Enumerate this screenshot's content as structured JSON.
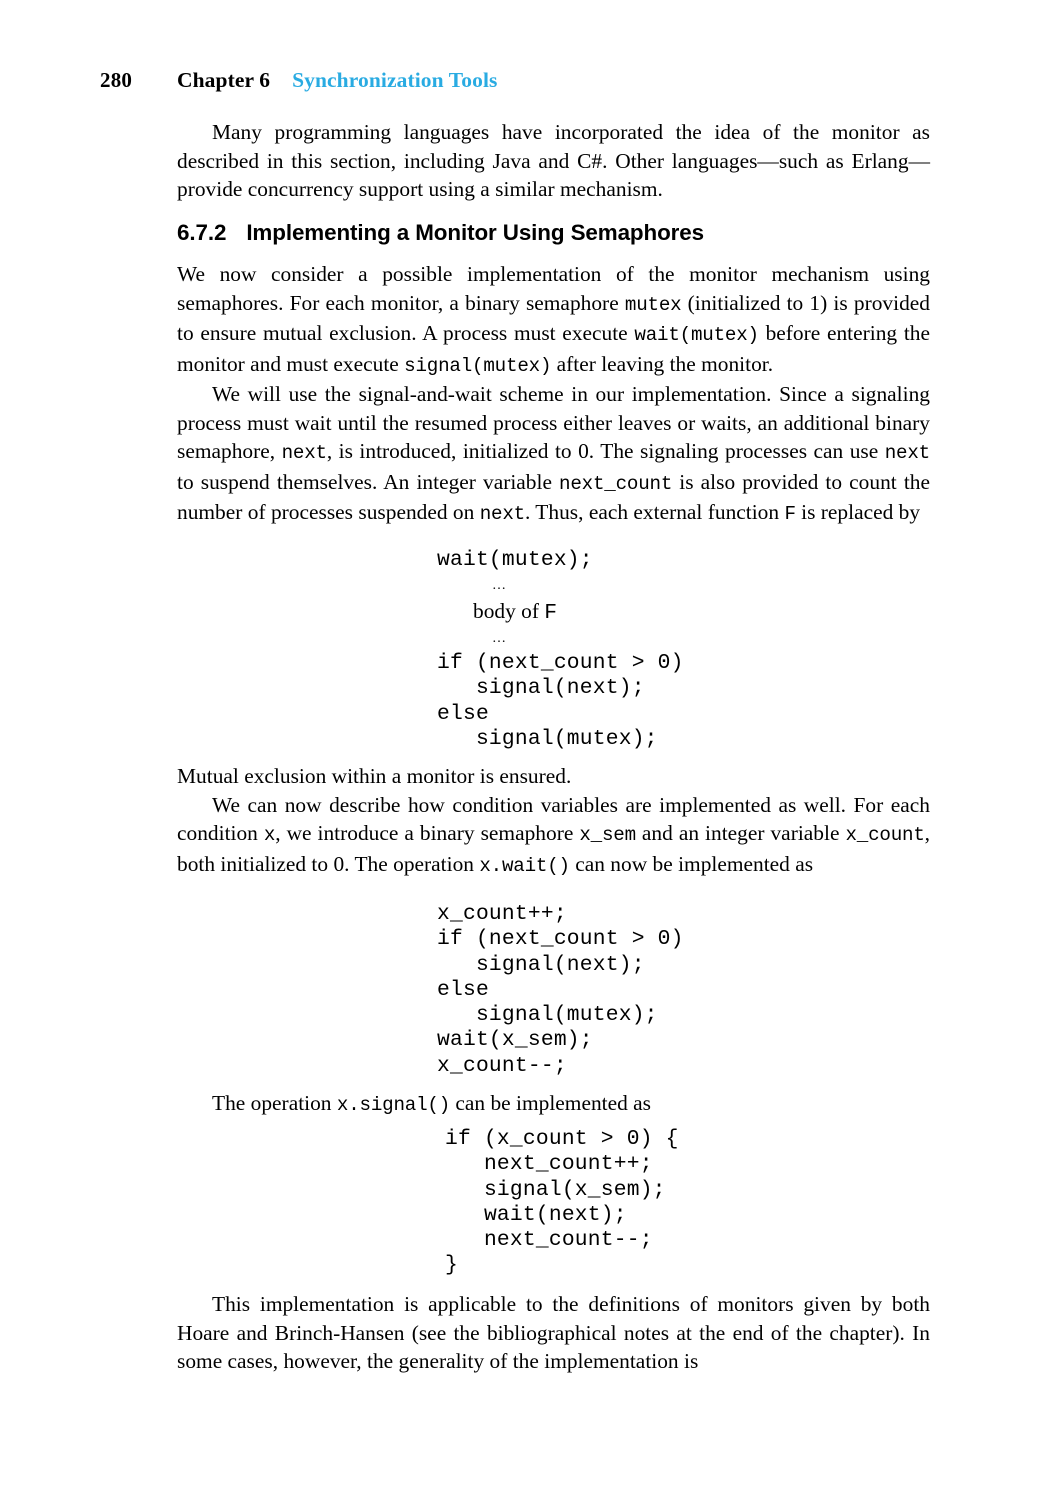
{
  "page": {
    "folio": "280",
    "chapter_label": "Chapter 6",
    "chapter_title": "Synchronization Tools",
    "accent_color": "#29ABE2"
  },
  "section": {
    "number": "6.7.2",
    "title": "Implementing a Monitor Using Semaphores"
  },
  "paragraphs": {
    "p1": "Many programming languages have incorporated the idea of the monitor as described in this section, including Java and C#. Other languages—such as Erlang—provide concurrency support using a similar mechanism.",
    "p2_a": "We now consider a possible implementation of the monitor mechanism using semaphores. For each monitor, a binary semaphore ",
    "p2_code1": "mutex",
    "p2_b": " (initialized to 1) is provided to ensure mutual exclusion. A process must execute ",
    "p2_code2": "wait(mutex)",
    "p2_c": " before entering the monitor and must execute ",
    "p2_code3": "signal(mutex)",
    "p2_d": " after leaving the monitor.",
    "p3_a": "We will use the signal-and-wait scheme in our implementation. Since a signaling process must wait until the resumed process either leaves or waits, an additional binary semaphore, ",
    "p3_code1": "next",
    "p3_b": ", is introduced, initialized to 0. The signaling processes can use ",
    "p3_code2": "next",
    "p3_c": " to suspend themselves. An integer variable ",
    "p3_code3": "next_count",
    "p3_d": " is also provided to count the number of processes suspended on ",
    "p3_code4": "next",
    "p3_e": ". Thus, each external function ",
    "p3_code5": "F",
    "p3_f": " is replaced by",
    "p4": "Mutual exclusion within a monitor is ensured.",
    "p5_a": "We can now describe how condition variables are implemented as well. For each condition ",
    "p5_code1": "x",
    "p5_b": ", we introduce a binary semaphore ",
    "p5_code2": "x_sem",
    "p5_c": " and an integer variable ",
    "p5_code3": "x_count",
    "p5_d": ", both initialized to 0. The operation ",
    "p5_code4": "x.wait()",
    "p5_e": " can now be implemented as",
    "p6_a": "The operation ",
    "p6_code1": "x.signal()",
    "p6_b": " can be implemented as",
    "p7": "This implementation is applicable to the definitions of monitors given by both Hoare and Brinch-Hansen (see the bibliographical notes at the end of the chapter). In some cases, however, the generality of the implementation is"
  },
  "code_blocks": {
    "block1": {
      "line1": "wait(mutex);",
      "line2_ellipsis": "…",
      "line3_serif": "body of ",
      "line3_mono": "F",
      "line4_ellipsis": "…",
      "line5": "if (next_count > 0)",
      "line6": "   signal(next);",
      "line7": "else",
      "line8": "   signal(mutex);"
    },
    "block2": "x_count++;\nif (next_count > 0)\n   signal(next);\nelse\n   signal(mutex);\nwait(x_sem);\nx_count--;",
    "block3": "if (x_count > 0) {\n   next_count++;\n   signal(x_sem);\n   wait(next);\n   next_count--;\n}"
  }
}
